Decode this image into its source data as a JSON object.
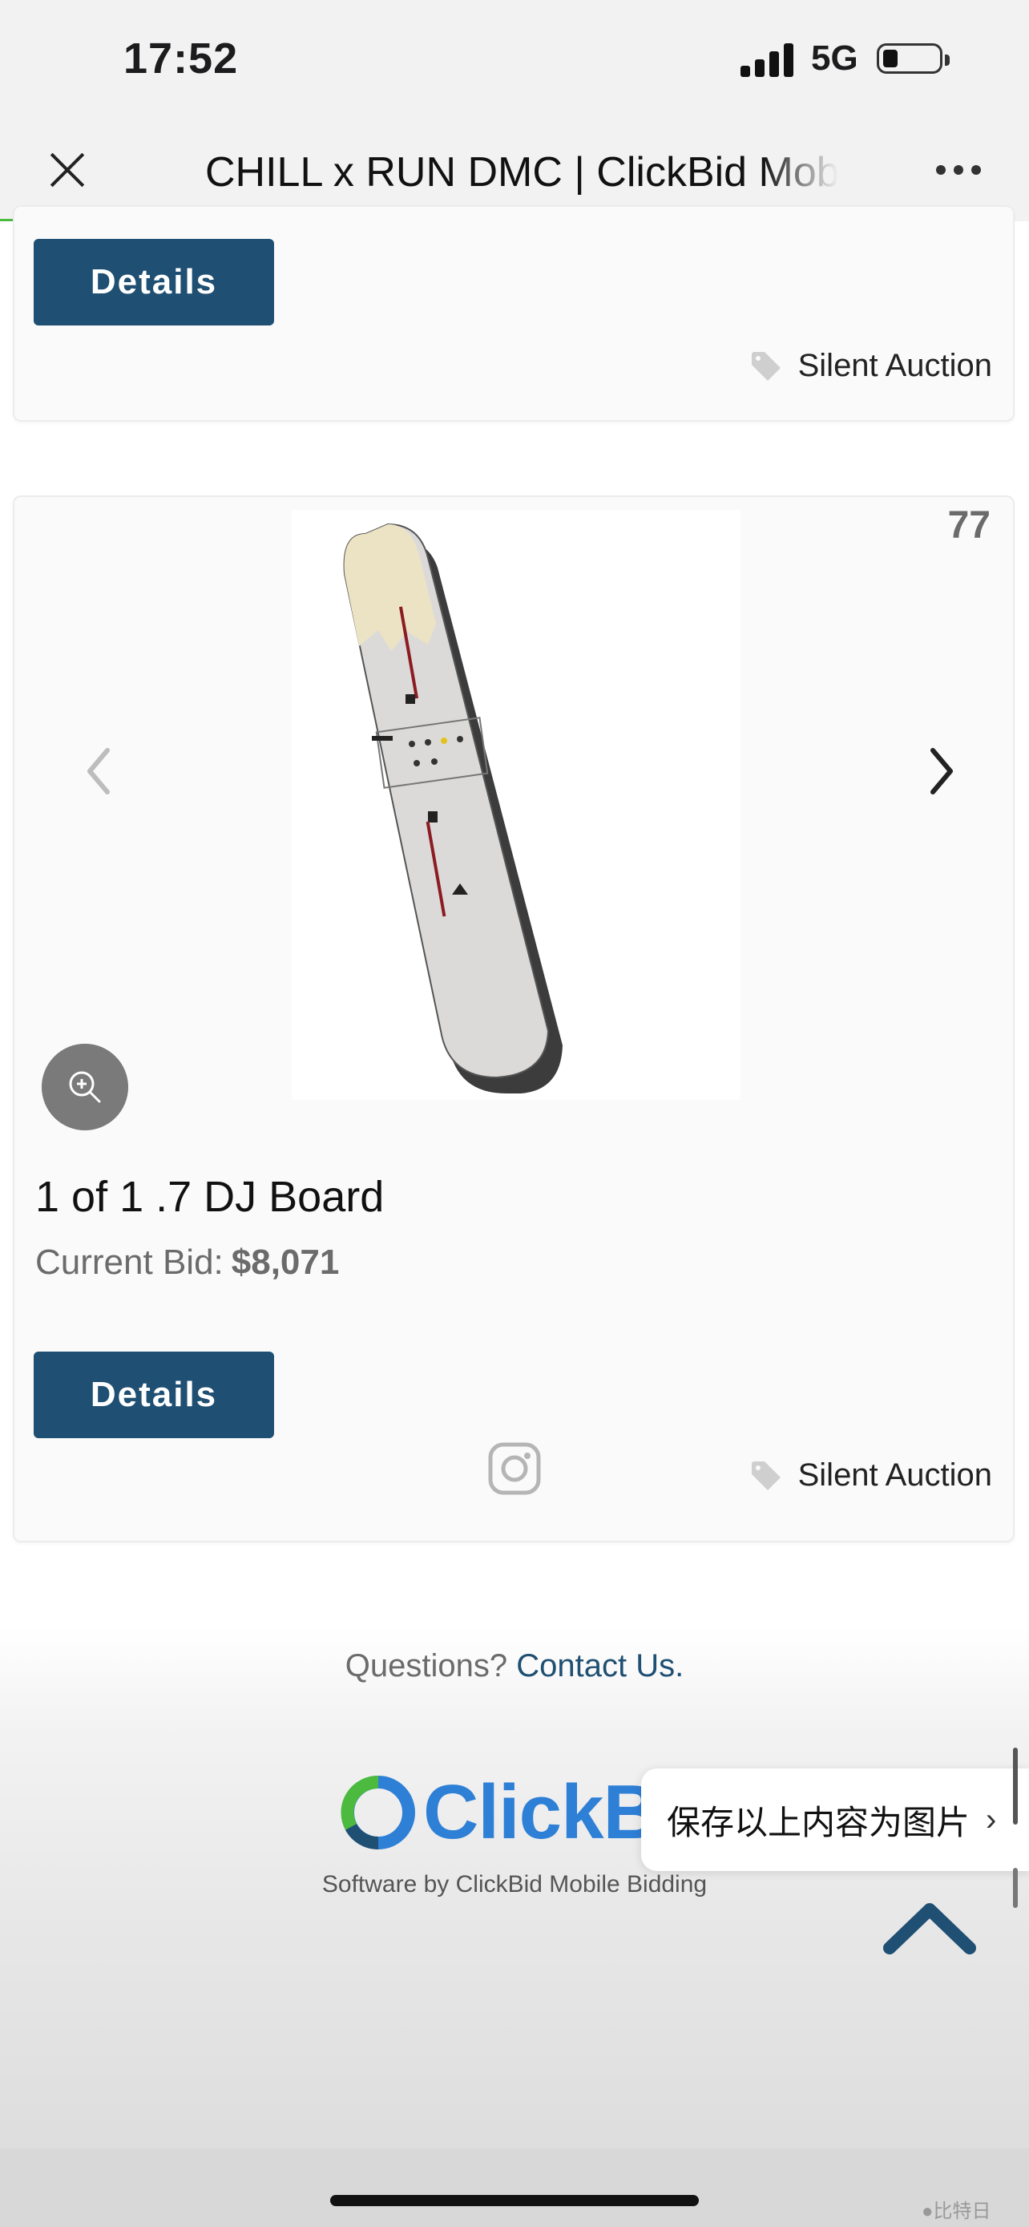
{
  "status_bar": {
    "time": "17:52",
    "network": "5G",
    "battery_level": 0.2
  },
  "nav": {
    "title": "CHILL x RUN DMC | ClickBid Mobile Bidding",
    "load_progress": 0.92
  },
  "cards": [
    {
      "details_label": "Details",
      "category": "Silent Auction"
    },
    {
      "number": "77",
      "title": "1 of 1 .7 DJ Board",
      "current_bid_label": "Current Bid:",
      "current_bid": "$8,071",
      "details_label": "Details",
      "category": "Silent Auction"
    }
  ],
  "footer": {
    "questions": "Questions?",
    "contact_link": "Contact Us.",
    "logo_text": "ClickBi",
    "software_by": "Software by ClickBid Mobile Bidding"
  },
  "popup": {
    "label": "保存以上内容为图片"
  },
  "watermark": "●比特日",
  "icons": {
    "close": "close-icon",
    "more": "more-icon",
    "tag": "tag-icon",
    "prev": "chevron-left-icon",
    "next": "chevron-right-icon",
    "zoom": "zoom-in-icon",
    "instagram": "instagram-icon",
    "scroll_top": "chevron-up-icon"
  },
  "colors": {
    "accent": "#1f4f72",
    "progress": "#4cba3e",
    "brand": "#2e7fd6"
  }
}
